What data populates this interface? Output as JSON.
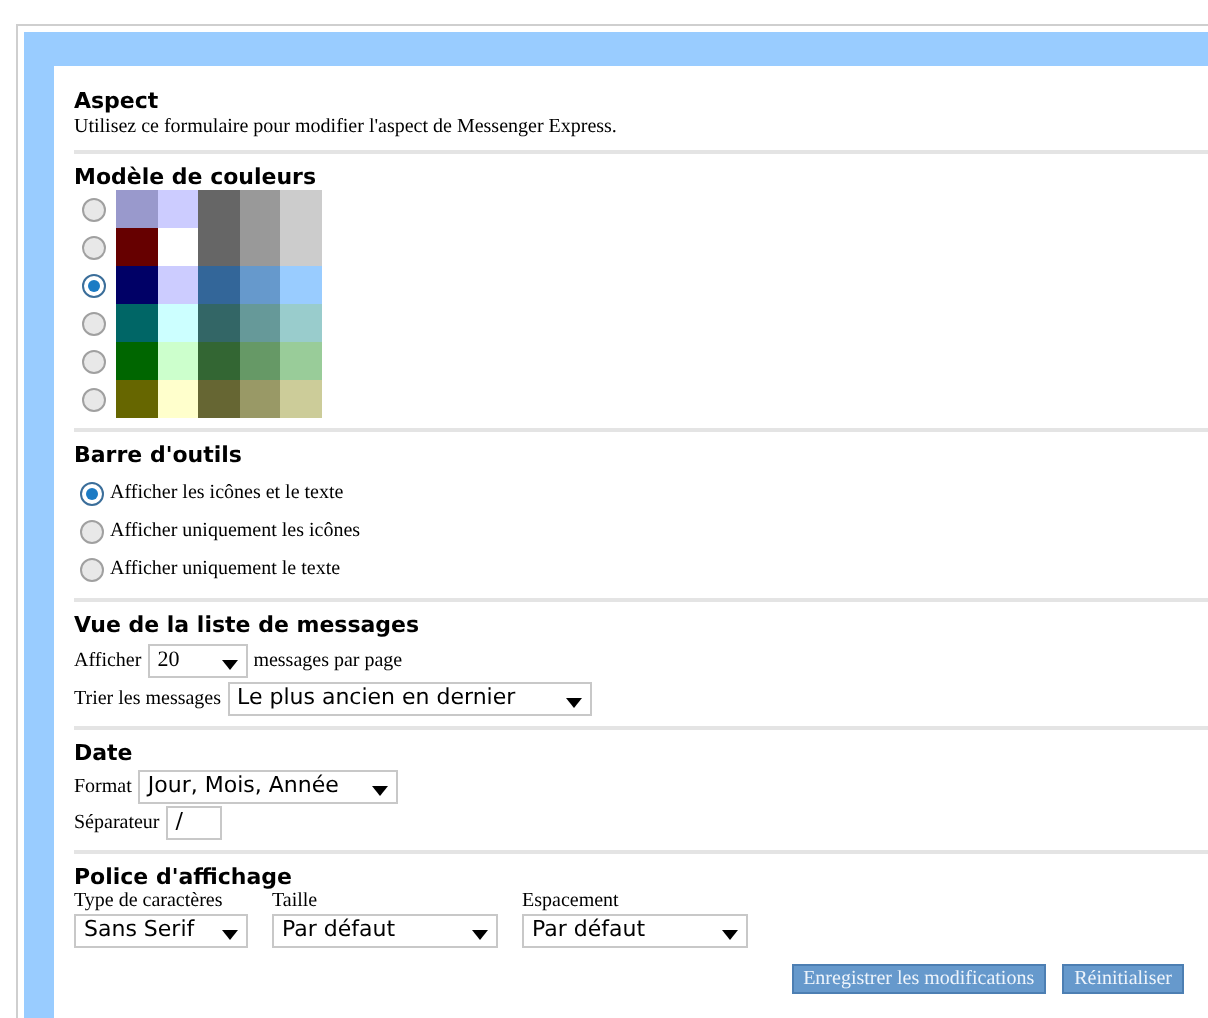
{
  "aspect": {
    "title": "Aspect",
    "description": "Utilisez ce formulaire pour modifier l'aspect de Messenger Express."
  },
  "color_schemes": {
    "title": "Modèle de couleurs",
    "options": [
      {
        "selected": false,
        "swatches": [
          {
            "color": "#9999cc"
          },
          {
            "color": "#ccccff"
          },
          {
            "color": "#666666"
          },
          {
            "color": "#999999"
          },
          {
            "color": "#cccccc"
          }
        ]
      },
      {
        "selected": false,
        "swatches": [
          {
            "color": "#660000"
          },
          {
            "color": "#ffffff"
          },
          {
            "color": "#666666"
          },
          {
            "color": "#999999"
          },
          {
            "color": "#cccccc"
          }
        ]
      },
      {
        "selected": true,
        "swatches": [
          {
            "color": "#000066"
          },
          {
            "color": "#ccccff"
          },
          {
            "color": "#336699"
          },
          {
            "color": "#6699cc"
          },
          {
            "color": "#99ccff"
          }
        ]
      },
      {
        "selected": false,
        "swatches": [
          {
            "color": "#006666"
          },
          {
            "color": "#ccffff"
          },
          {
            "color": "#336666"
          },
          {
            "color": "#669999"
          },
          {
            "color": "#99cccc"
          }
        ]
      },
      {
        "selected": false,
        "swatches": [
          {
            "color": "#006600"
          },
          {
            "color": "#ccffcc"
          },
          {
            "color": "#336633"
          },
          {
            "color": "#669966"
          },
          {
            "color": "#99cc99"
          }
        ]
      },
      {
        "selected": false,
        "swatches": [
          {
            "color": "#666600"
          },
          {
            "color": "#ffffcc"
          },
          {
            "color": "#666633"
          },
          {
            "color": "#999966"
          },
          {
            "color": "#cccc99"
          }
        ]
      }
    ]
  },
  "toolbar": {
    "title": "Barre d'outils",
    "options": [
      {
        "label": "Afficher les icônes et le texte",
        "selected": true
      },
      {
        "label": "Afficher uniquement les icônes",
        "selected": false
      },
      {
        "label": "Afficher uniquement le texte",
        "selected": false
      }
    ]
  },
  "message_list": {
    "title": "Vue de la liste de messages",
    "show_label": "Afficher",
    "show_value": "20",
    "show_suffix": "messages par page",
    "sort_label": "Trier les messages",
    "sort_value": "Le plus ancien en dernier"
  },
  "date": {
    "title": "Date",
    "format_label": "Format",
    "format_value": "Jour, Mois, Année",
    "separator_label": "Séparateur",
    "separator_value": "/"
  },
  "font": {
    "title": "Police d'affichage",
    "fields": [
      {
        "label": "Type de caractères",
        "value": "Sans Serif"
      },
      {
        "label": "Taille",
        "value": "Par défaut"
      },
      {
        "label": "Espacement",
        "value": "Par défaut"
      }
    ]
  },
  "buttons": [
    "Enregistrer les modifications",
    "Réinitialiser"
  ]
}
